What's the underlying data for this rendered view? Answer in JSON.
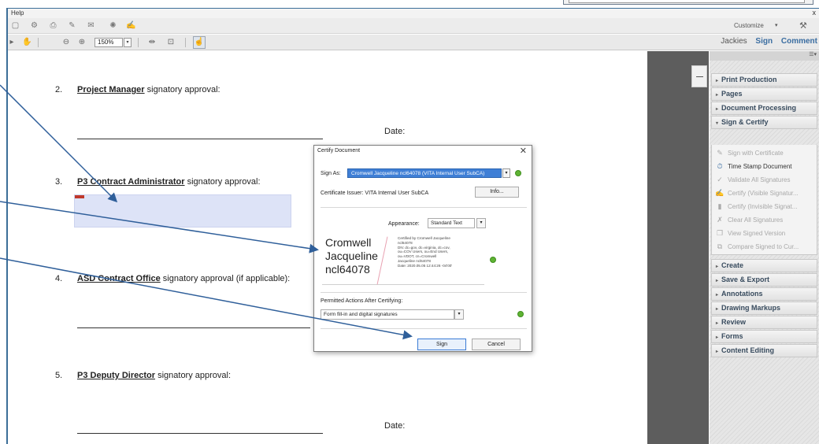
{
  "menu": {
    "help_label": "Help",
    "close_label": "x"
  },
  "toolbar": {
    "customize_label": "Customize",
    "customize_arrow": "▾",
    "zoom_value": "150%",
    "zoom_arrow": "▾"
  },
  "pane_tabs": {
    "user_label": "Jackies",
    "sign_label": "Sign",
    "comment_label": "Comment"
  },
  "document": {
    "items": [
      {
        "num": "2.",
        "title": "Project Manager",
        "rest": " signatory approval:"
      },
      {
        "num": "3.",
        "title": "P3 Contract Administrator",
        "rest": " signatory approval:"
      },
      {
        "num": "4.",
        "title": "ASD Contract Office",
        "rest": " signatory approval (if applicable):"
      },
      {
        "num": "5.",
        "title": "P3 Deputy Director",
        "rest": " signatory approval:"
      }
    ],
    "date_label": "Date:"
  },
  "tools_pane": {
    "top_glyph": "☰▾",
    "panels": {
      "print_production": "Print Production",
      "pages": "Pages",
      "document_processing": "Document Processing",
      "sign_certify": "Sign & Certify",
      "create": "Create",
      "save_export": "Save & Export",
      "annotations": "Annotations",
      "drawing_markups": "Drawing Markups",
      "review": "Review",
      "forms": "Forms",
      "content_editing": "Content Editing"
    },
    "sign_certify_items": [
      {
        "label": "Sign with Certificate",
        "icon": "pen-icon"
      },
      {
        "label": "Time Stamp Document",
        "icon": "stamp-icon"
      },
      {
        "label": "Validate All Signatures",
        "icon": "validate-icon"
      },
      {
        "label": "Certify (Visible Signatur...",
        "icon": "certify-visible-icon"
      },
      {
        "label": "Certify (Invisible Signat...",
        "icon": "certify-invisible-icon"
      },
      {
        "label": "Clear All Signatures",
        "icon": "clear-icon"
      },
      {
        "label": "View Signed Version",
        "icon": "view-signed-icon"
      },
      {
        "label": "Compare Signed to Cur...",
        "icon": "compare-icon"
      }
    ]
  },
  "dialog": {
    "title": "Certify Document",
    "close_label": "✕",
    "sign_as_label": "Sign As:",
    "sign_as_value": "Cromwell Jacqueline ncl64078 (VITA Internal User SubCA)",
    "issuer_text": "Certificate Issuer: VITA Internal User SubCA",
    "info_label": "Info...",
    "appearance_label": "Appearance:",
    "appearance_value": "Standard Text",
    "preview_name_1": "Cromwell",
    "preview_name_2": "Jacqueline",
    "preview_name_3": "ncl64078",
    "preview_details": "Certified by Cromwell Jacqueline\nncl64078\nDN: dc=gov, dc=virginia, dc=cov,\nou=COV Users, ou=End Users,\nou=VDOT, cn=Cromwell\nJacqueline ncl64078\nDate: 2020.05.05 12:44:26 -04'00'",
    "permitted_label": "Permitted Actions After Certifying:",
    "permitted_value": "Form fill-in and digital signatures",
    "sign_label": "Sign",
    "cancel_label": "Cancel"
  },
  "colors": {
    "accent": "#3f7fd6",
    "panel_text": "#384b5e",
    "arrow": "#2f5f9a",
    "signature_field": "#dde3f7",
    "green_indicator": "#5fb333"
  }
}
